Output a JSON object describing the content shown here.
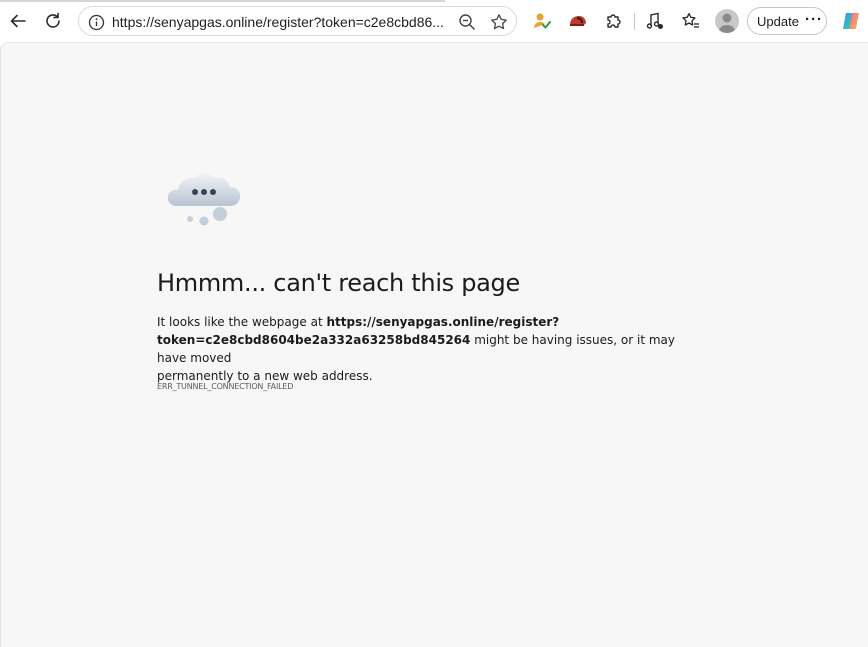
{
  "browser": {
    "url": "https://senyapgas.online/register?token=c2e8cbd86...",
    "update_label": "Update",
    "more_label": "···"
  },
  "error_page": {
    "heading": "Hmmm... can't reach this page",
    "message_prefix": "It looks like the webpage at ",
    "message_url_line1": "https://senyapgas.online/register?",
    "message_url_line2": "token=c2e8cbd8604be2a332a63258bd845264",
    "message_suffix": " might be having issues, or it may have moved",
    "message_line3": "permanently to a new web address.",
    "error_code": "ERR_TUNNEL_CONNECTION_FAILED"
  },
  "icons": {
    "back": "back-arrow-icon",
    "refresh": "refresh-icon",
    "info": "info-icon",
    "zoom": "zoom-out-icon",
    "favorite": "star-icon",
    "ext1": "person-check-extension-icon",
    "ext2": "helmet-extension-icon",
    "extensions": "puzzle-icon",
    "media": "music-note-icon",
    "favorites": "favorites-icon",
    "profile": "avatar",
    "copilot": "copilot-icon"
  },
  "colors": {
    "page_bg": "#f7f7f7",
    "toolbar_bg": "#ffffff",
    "text": "#1b1b1b"
  }
}
